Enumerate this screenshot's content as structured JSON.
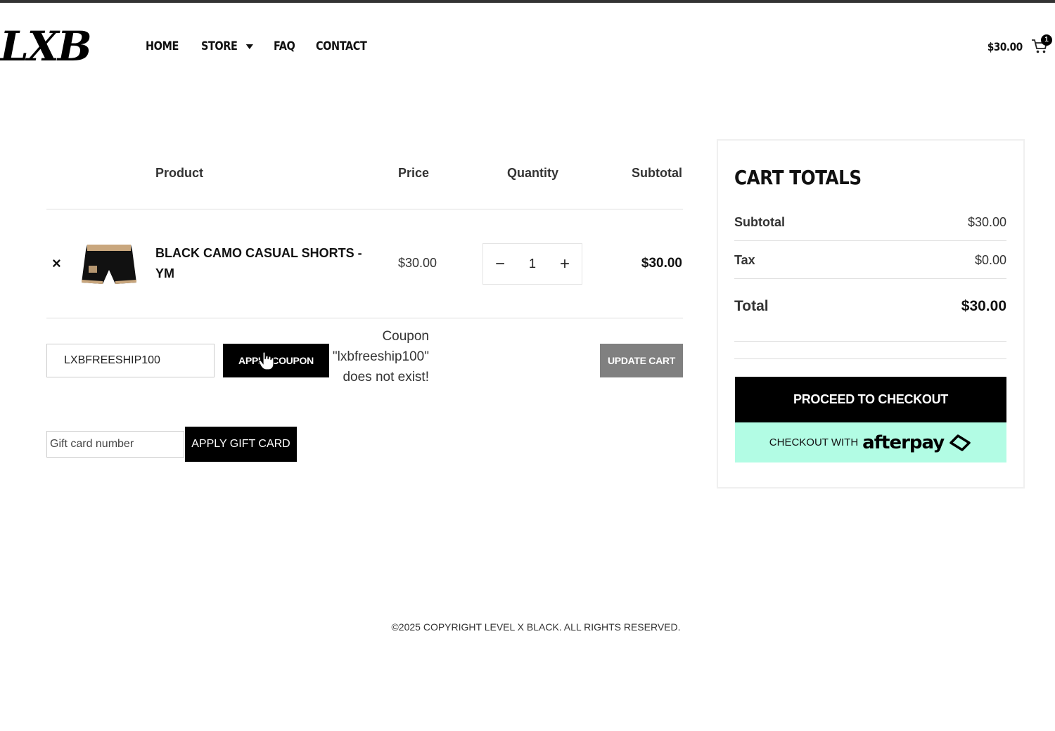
{
  "header": {
    "logo": "LXB",
    "nav": [
      "HOME",
      "STORE",
      "FAQ",
      "CONTACT"
    ],
    "cart_amount": "$30.00",
    "cart_count": "1"
  },
  "table": {
    "headers": {
      "product": "Product",
      "price": "Price",
      "quantity": "Quantity",
      "subtotal": "Subtotal"
    },
    "row": {
      "remove": "×",
      "name": "BLACK CAMO CASUAL SHORTS - YM",
      "price": "$30.00",
      "qty": "1",
      "subtotal": "$30.00"
    }
  },
  "coupon": {
    "value": "LXBFREESHIP100",
    "apply_label": "APPLY COUPON",
    "error": "Coupon \"lxbfreeship100\" does not exist!",
    "update_label": "UPDATE CART"
  },
  "gift": {
    "placeholder": "Gift card number",
    "apply_label": "APPLY GIFT CARD"
  },
  "totals": {
    "title": "CART TOTALS",
    "subtotal_label": "Subtotal",
    "subtotal_value": "$30.00",
    "tax_label": "Tax",
    "tax_value": "$0.00",
    "total_label": "Total",
    "total_value": "$30.00",
    "checkout_label": "PROCEED TO CHECKOUT",
    "afterpay_pre": "CHECKOUT WITH",
    "afterpay_logo": "afterpay",
    "afterpay_color": "#b2fce4"
  },
  "footer": {
    "copyright": "©2025 COPYRIGHT LEVEL X BLACK. ALL RIGHTS RESERVED."
  }
}
